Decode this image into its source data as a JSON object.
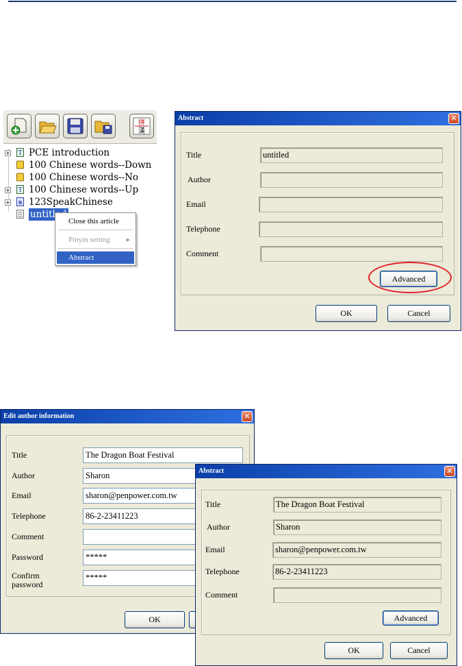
{
  "toolbar": {
    "buttons": [
      {
        "name": "new-article-icon"
      },
      {
        "name": "open-folder-icon"
      },
      {
        "name": "save-icon"
      },
      {
        "name": "save-as-folder-icon"
      },
      {
        "name": "pinyin-hanzi-icon",
        "glyph_top": "拼",
        "glyph_bottom": "漢"
      }
    ]
  },
  "tree": {
    "items": [
      {
        "label": "PCE introduction",
        "expander": "+",
        "icon": "text-doc-icon"
      },
      {
        "label": "100 Chinese words--Down",
        "expander": "",
        "icon": "lesson-icon"
      },
      {
        "label": "100 Chinese words--No",
        "expander": "",
        "icon": "lesson-icon"
      },
      {
        "label": "100 Chinese words--Up",
        "expander": "+",
        "icon": "text-doc-icon"
      },
      {
        "label": "123SpeakChinese",
        "expander": "+",
        "icon": "speak-icon"
      },
      {
        "label": "untitled",
        "expander": "",
        "icon": "blank-doc-icon"
      }
    ]
  },
  "context_menu": {
    "items": [
      "Close this article",
      "Pinyin setting",
      "Abstract"
    ],
    "submenu_arrow": "▶"
  },
  "abstract_dialog_1": {
    "title": "Abstract",
    "close": "✕",
    "labels": {
      "title": "Title",
      "author": "Author",
      "email": "Email",
      "telephone": "Telephone",
      "comment": "Comment"
    },
    "values": {
      "title": "untitled",
      "author": "",
      "email": "",
      "telephone": "",
      "comment": ""
    },
    "advanced": "Advanced",
    "ok": "OK",
    "cancel": "Cancel"
  },
  "edit_author_dialog": {
    "title": "Edit author information",
    "close": "✕",
    "labels": {
      "title": "Title",
      "author": "Author",
      "email": "Email",
      "telephone": "Telephone",
      "comment": "Comment",
      "password": "Password",
      "confirm_line1": "Confirm",
      "confirm_line2": "password"
    },
    "values": {
      "title": "The Dragon Boat Festival",
      "author": "Sharon",
      "email": "sharon@penpower.com.tw",
      "telephone": "86-2-23411223",
      "comment": "",
      "password": "*****",
      "confirm": "*****"
    },
    "ok": "OK"
  },
  "abstract_dialog_2": {
    "title": "Abstract",
    "close": "✕",
    "labels": {
      "title": "Title",
      "author": "Author",
      "email": "Email",
      "telephone": "Telephone",
      "comment": "Comment"
    },
    "values": {
      "title": "The Dragon Boat Festival",
      "author": "Sharon",
      "email": "sharon@penpower.com.tw",
      "telephone": "86-2-23411223",
      "comment": ""
    },
    "advanced": "Advanced",
    "ok": "OK",
    "cancel": "Cancel"
  },
  "colors": {
    "title_bar": "#0b3fa8",
    "dialog_bg": "#ecead8",
    "selection": "#3163c5",
    "highlight_ring": "#e0202a"
  }
}
